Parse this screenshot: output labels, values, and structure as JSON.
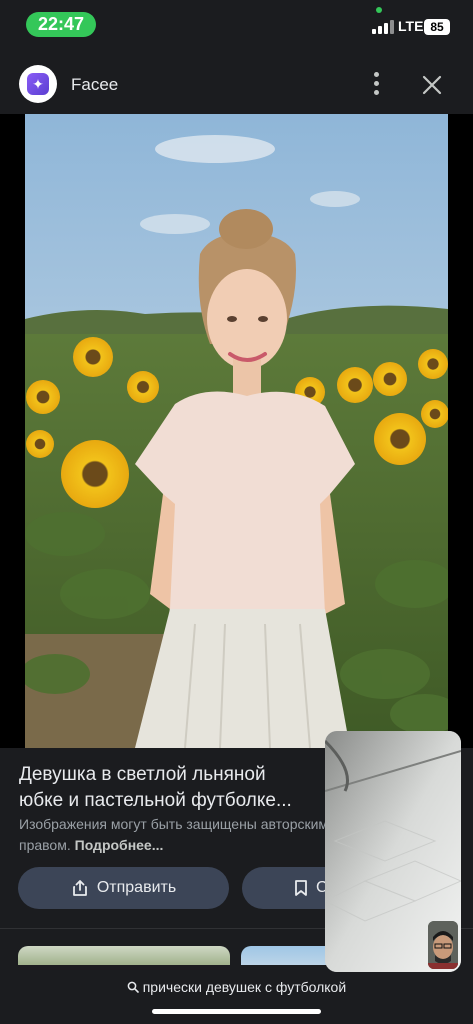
{
  "status_bar": {
    "time": "22:47",
    "network": "LTE",
    "battery": "85"
  },
  "header": {
    "app_name": "Facee"
  },
  "result": {
    "title": "Девушка в светлой льняной юбке и пастельной футболке...",
    "copyright_text": "Изображения могут быть защищены авторским правом.",
    "more_link": "Подробнее...",
    "send_label": "Отправить",
    "save_label": "С"
  },
  "search": {
    "query": "прически девушек с футболкой"
  },
  "colors": {
    "accent_green": "#34c759",
    "button_bg": "#3c4557",
    "panel_bg": "#1b1c1f"
  }
}
